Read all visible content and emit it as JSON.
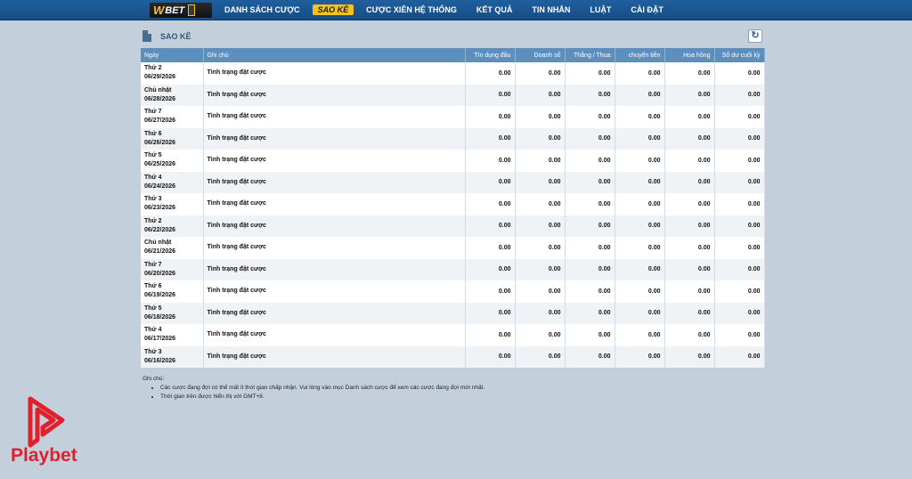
{
  "brand": {
    "logo_w": "W",
    "logo_bet": "BET",
    "watermark": "Playbet"
  },
  "nav": [
    {
      "label": "DANH SÁCH CƯỢC",
      "active": false
    },
    {
      "label": "SAO KÊ",
      "active": true
    },
    {
      "label": "CƯỢC XIÊN HỆ THỐNG",
      "active": false
    },
    {
      "label": "KẾT QUẢ",
      "active": false
    },
    {
      "label": "TIN NHẮN",
      "active": false
    },
    {
      "label": "LUẬT",
      "active": false
    },
    {
      "label": "CÀI ĐẶT",
      "active": false
    }
  ],
  "page": {
    "title": "SAO KÊ",
    "refresh_icon": "↻"
  },
  "table": {
    "headers": [
      "Ngày",
      "Ghi chú",
      "Tín dụng đầu",
      "Doanh số",
      "Thắng / Thua",
      "chuyển tiền",
      "Hoa hồng",
      "Số dư cuối kỳ"
    ],
    "rows": [
      {
        "day": "Thứ 2",
        "date": "06/29/2026",
        "note": "Tình trạng đặt cược",
        "v": [
          "0.00",
          "0.00",
          "0.00",
          "0.00",
          "0.00",
          "0.00"
        ]
      },
      {
        "day": "Chủ nhật",
        "date": "06/28/2026",
        "note": "Tình trạng đặt cược",
        "v": [
          "0.00",
          "0.00",
          "0.00",
          "0.00",
          "0.00",
          "0.00"
        ]
      },
      {
        "day": "Thứ 7",
        "date": "06/27/2026",
        "note": "Tình trạng đặt cược",
        "v": [
          "0.00",
          "0.00",
          "0.00",
          "0.00",
          "0.00",
          "0.00"
        ]
      },
      {
        "day": "Thứ 6",
        "date": "06/26/2026",
        "note": "Tình trạng đặt cược",
        "v": [
          "0.00",
          "0.00",
          "0.00",
          "0.00",
          "0.00",
          "0.00"
        ]
      },
      {
        "day": "Thứ 5",
        "date": "06/25/2026",
        "note": "Tình trạng đặt cược",
        "v": [
          "0.00",
          "0.00",
          "0.00",
          "0.00",
          "0.00",
          "0.00"
        ]
      },
      {
        "day": "Thứ 4",
        "date": "06/24/2026",
        "note": "Tình trạng đặt cược",
        "v": [
          "0.00",
          "0.00",
          "0.00",
          "0.00",
          "0.00",
          "0.00"
        ]
      },
      {
        "day": "Thứ 3",
        "date": "06/23/2026",
        "note": "Tình trạng đặt cược",
        "v": [
          "0.00",
          "0.00",
          "0.00",
          "0.00",
          "0.00",
          "0.00"
        ]
      },
      {
        "day": "Thứ 2",
        "date": "06/22/2026",
        "note": "Tình trạng đặt cược",
        "v": [
          "0.00",
          "0.00",
          "0.00",
          "0.00",
          "0.00",
          "0.00"
        ]
      },
      {
        "day": "Chủ nhật",
        "date": "06/21/2026",
        "note": "Tình trạng đặt cược",
        "v": [
          "0.00",
          "0.00",
          "0.00",
          "0.00",
          "0.00",
          "0.00"
        ]
      },
      {
        "day": "Thứ 7",
        "date": "06/20/2026",
        "note": "Tình trạng đặt cược",
        "v": [
          "0.00",
          "0.00",
          "0.00",
          "0.00",
          "0.00",
          "0.00"
        ]
      },
      {
        "day": "Thứ 6",
        "date": "06/19/2026",
        "note": "Tình trạng đặt cược",
        "v": [
          "0.00",
          "0.00",
          "0.00",
          "0.00",
          "0.00",
          "0.00"
        ]
      },
      {
        "day": "Thứ 5",
        "date": "06/18/2026",
        "note": "Tình trạng đặt cược",
        "v": [
          "0.00",
          "0.00",
          "0.00",
          "0.00",
          "0.00",
          "0.00"
        ]
      },
      {
        "day": "Thứ 4",
        "date": "06/17/2026",
        "note": "Tình trạng đặt cược",
        "v": [
          "0.00",
          "0.00",
          "0.00",
          "0.00",
          "0.00",
          "0.00"
        ]
      },
      {
        "day": "Thứ 3",
        "date": "06/16/2026",
        "note": "Tình trạng đặt cược",
        "v": [
          "0.00",
          "0.00",
          "0.00",
          "0.00",
          "0.00",
          "0.00"
        ]
      }
    ]
  },
  "notes": {
    "heading": "Ghi chú:",
    "items": [
      "Các cược đang đợi có thể mất ít thời gian chấp nhận. Vui lòng vào mục Danh sách cược để xem các cược đang đợi mới nhất.",
      "Thời gian trên được hiển thị với GMT+8."
    ]
  },
  "colors": {
    "nav_bg": "#1f5f9e",
    "active_tab": "#f5c31b",
    "header_bg": "#5a8fc0",
    "page_bg": "#c3d0dc",
    "brand_red": "#e0212b"
  }
}
